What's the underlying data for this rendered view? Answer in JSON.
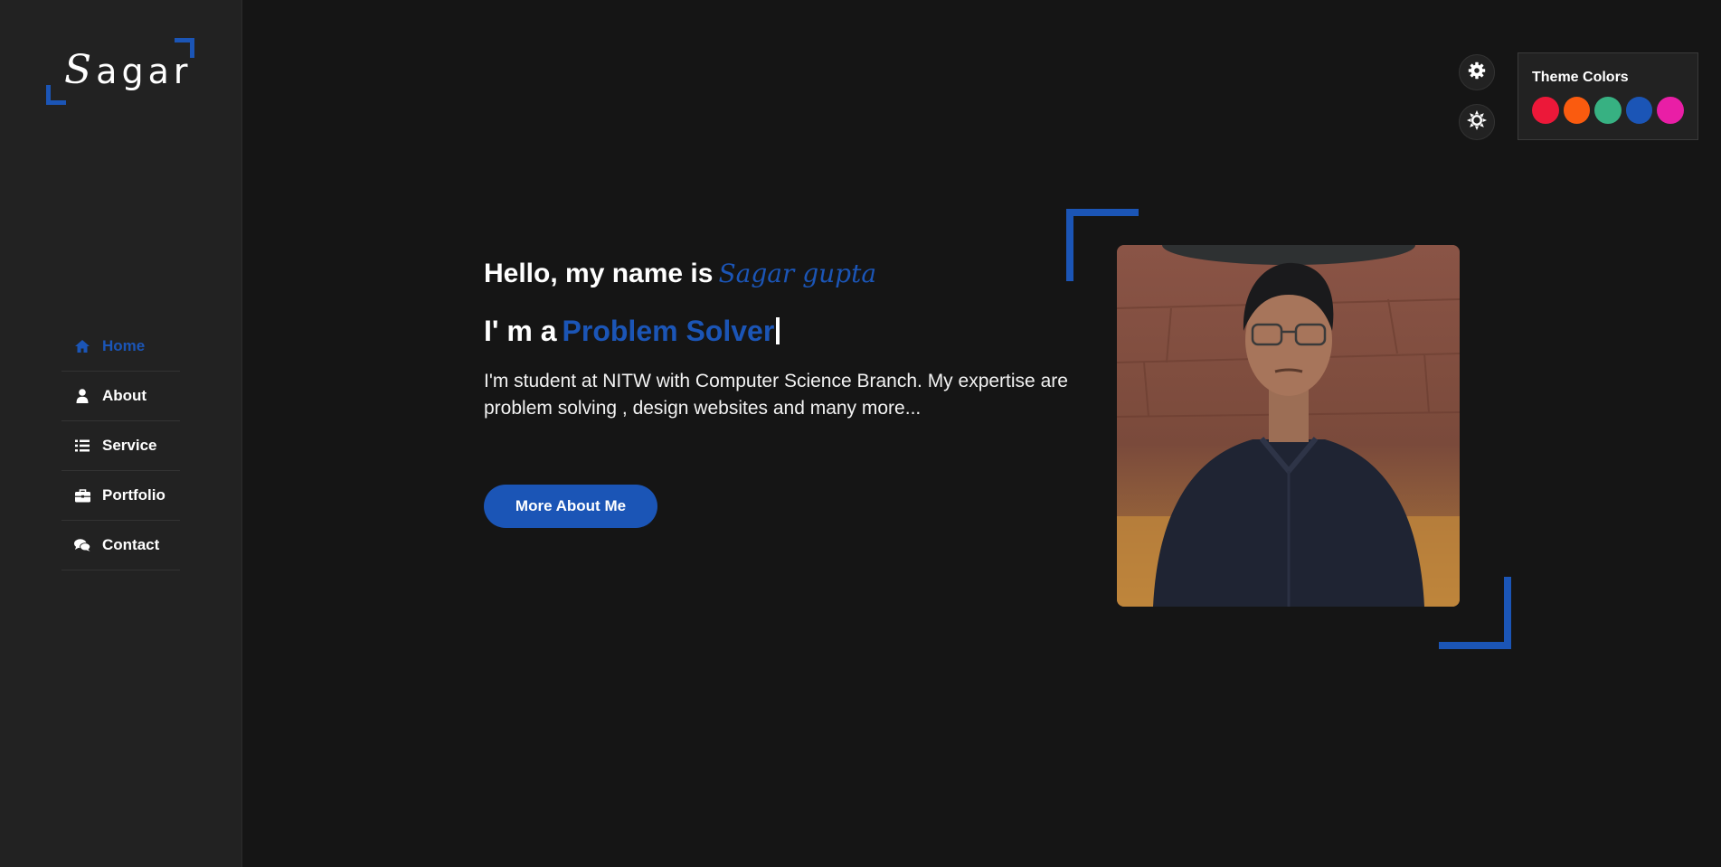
{
  "logo": {
    "text_first": "S",
    "text_rest": "agar"
  },
  "nav": {
    "items": [
      {
        "label": "Home",
        "icon": "home-icon",
        "active": true
      },
      {
        "label": "About",
        "icon": "user-icon",
        "active": false
      },
      {
        "label": "Service",
        "icon": "list-icon",
        "active": false
      },
      {
        "label": "Portfolio",
        "icon": "briefcase-icon",
        "active": false
      },
      {
        "label": "Contact",
        "icon": "comments-icon",
        "active": false
      }
    ]
  },
  "controls": {
    "settings_icon": "gear-icon",
    "mode_icon": "sun-icon"
  },
  "theme": {
    "title": "Theme Colors",
    "colors": [
      "#ec1839",
      "#fa5b0f",
      "#37b182",
      "#1b55b6",
      "#e91ea6"
    ]
  },
  "hero": {
    "greeting": "Hello, my name is",
    "name": "Sagar gupta",
    "role_prefix": "I' m a",
    "role": "Problem Solver",
    "description": "I'm student at NITW with Computer Science Branch. My expertise are problem solving , design websites and many more...",
    "button_label": "More About Me"
  },
  "colors": {
    "accent": "#1b55b6",
    "background": "#151515",
    "sidebar": "#222222"
  }
}
